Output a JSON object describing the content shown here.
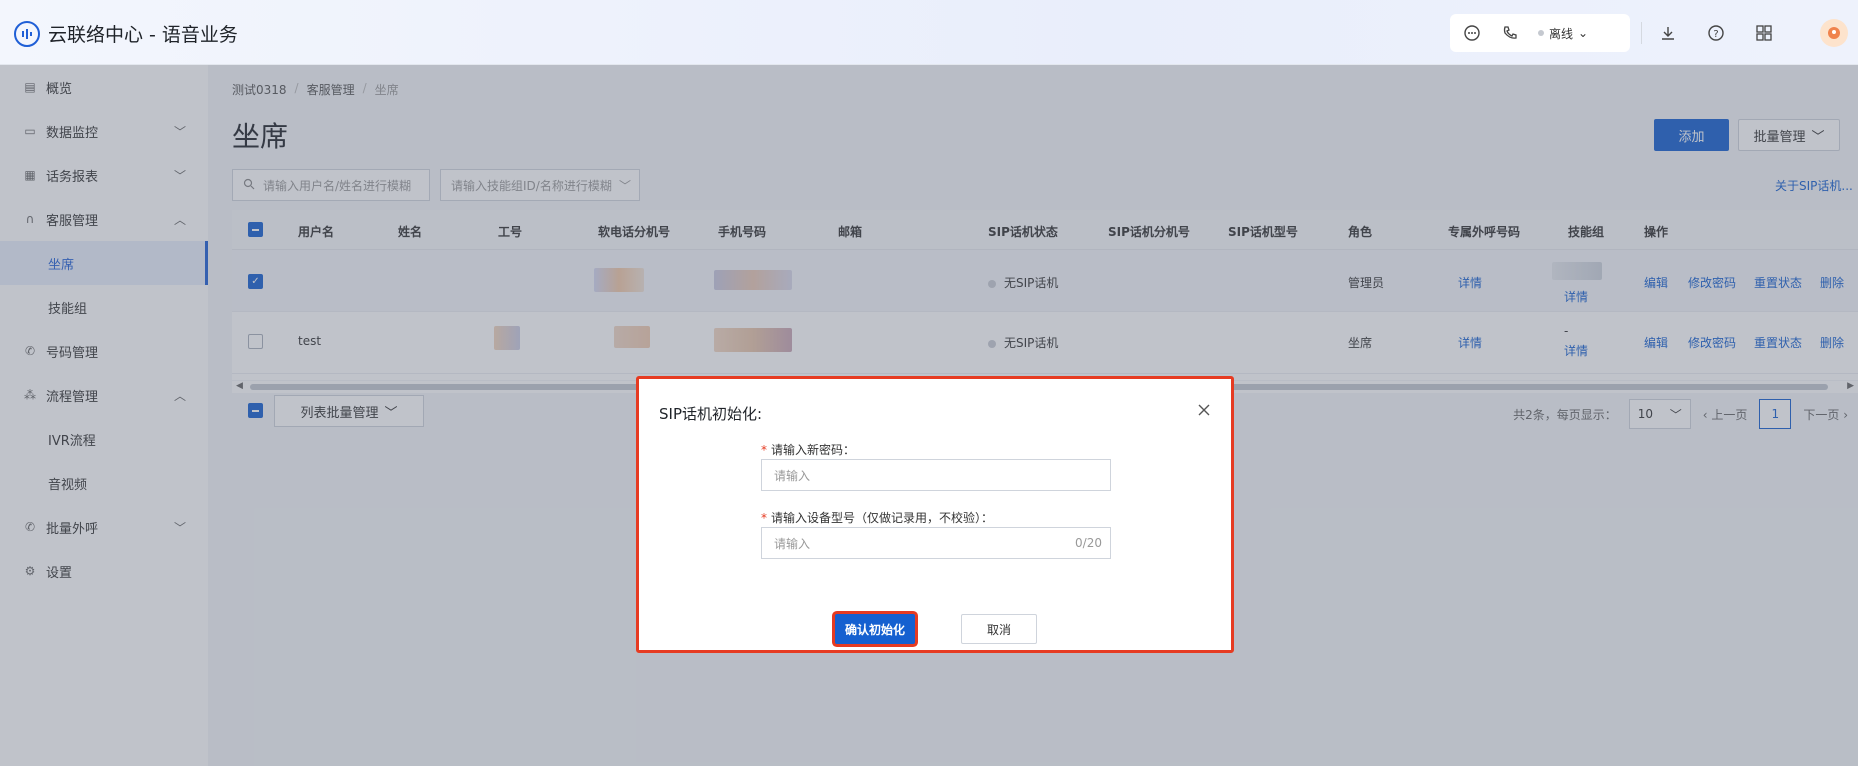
{
  "header": {
    "app_title": "云联络中心 - 语音业务",
    "status_label": "离线"
  },
  "sidebar": {
    "items": [
      {
        "label": "概览",
        "icon": "overview-icon"
      },
      {
        "label": "数据监控",
        "icon": "monitor-icon"
      },
      {
        "label": "话务报表",
        "icon": "report-icon"
      },
      {
        "label": "客服管理",
        "icon": "headset-icon"
      },
      {
        "label": "坐席"
      },
      {
        "label": "技能组"
      },
      {
        "label": "号码管理",
        "icon": "phone-icon"
      },
      {
        "label": "流程管理",
        "icon": "flow-icon"
      },
      {
        "label": "IVR流程"
      },
      {
        "label": "音视频"
      },
      {
        "label": "批量外呼",
        "icon": "outbound-icon"
      },
      {
        "label": "设置",
        "icon": "settings-icon"
      }
    ]
  },
  "breadcrumb": [
    "测试0318",
    "客服管理",
    "坐席"
  ],
  "page": {
    "title": "坐席",
    "add_button": "添加",
    "batch_button": "批量管理",
    "search_user_placeholder": "请输入用户名/姓名进行模糊",
    "search_group_placeholder": "请输入技能组ID/名称进行模糊",
    "sip_link": "关于SIP话机..."
  },
  "table": {
    "columns": [
      "用户名",
      "姓名",
      "工号",
      "软电话分机号",
      "手机号码",
      "邮箱",
      "SIP话机状态",
      "SIP话机分机号",
      "SIP话机型号",
      "角色",
      "专属外呼号码",
      "技能组",
      "操作"
    ],
    "rows": [
      {
        "username": "",
        "sip_status": "无SIP话机",
        "role": "管理员",
        "exclusive": "详情",
        "skill": "详情",
        "skill_prefix": "",
        "checked": true
      },
      {
        "username": "test",
        "sip_status": "无SIP话机",
        "role": "坐席",
        "exclusive": "详情",
        "skill": "详情",
        "skill_prefix": "-",
        "checked": false
      }
    ],
    "actions": [
      "编辑",
      "修改密码",
      "重置状态",
      "删除"
    ]
  },
  "footer": {
    "list_batch_button": "列表批量管理",
    "total_text": "共2条，每页显示：",
    "page_size": "10",
    "prev": "上一页",
    "current_page": "1",
    "next": "下一页"
  },
  "modal": {
    "title": "SIP话机初始化:",
    "field1_label": "请输入新密码：",
    "field1_placeholder": "请输入",
    "field2_label": "请输入设备型号（仅做记录用，不校验）：",
    "field2_placeholder": "请输入",
    "field2_count": "0/20",
    "confirm": "确认初始化",
    "cancel": "取消",
    "required_mark": "*"
  }
}
